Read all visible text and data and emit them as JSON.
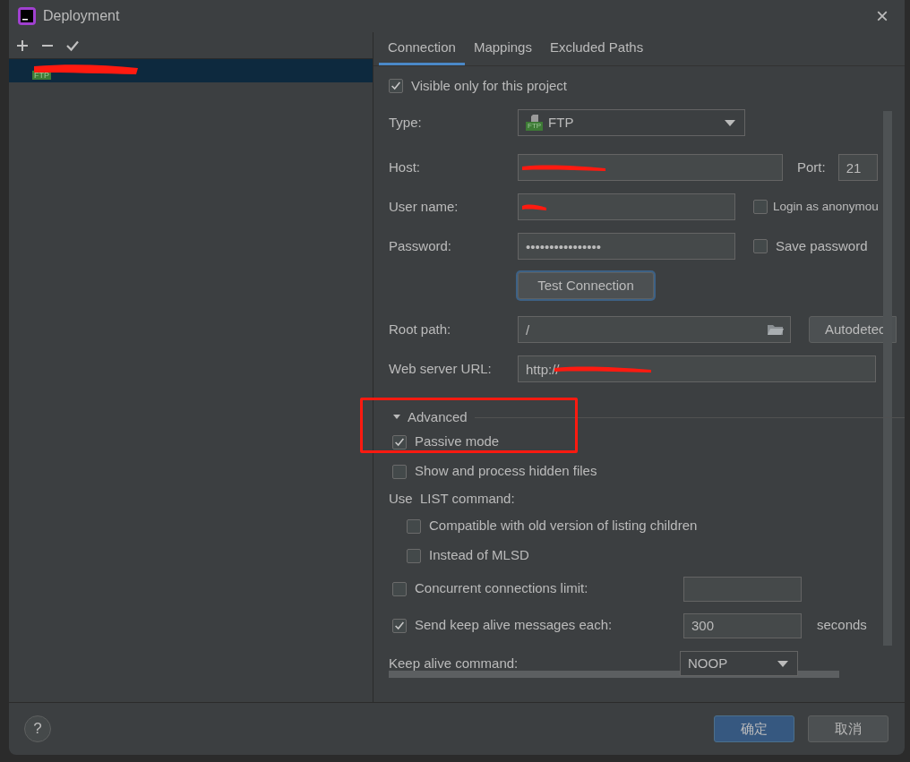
{
  "window": {
    "title": "Deployment",
    "close": "×"
  },
  "toolbar": [
    {
      "kind": "add"
    },
    {
      "kind": "remove"
    },
    {
      "kind": "check"
    }
  ],
  "servers": [
    {
      "badge": "FTP",
      "selected": true,
      "redacted": true
    }
  ],
  "tabs": [
    {
      "label": "Connection",
      "selected": true
    },
    {
      "label": "Mappings",
      "selected": false
    },
    {
      "label": "Excluded Paths",
      "selected": false
    }
  ],
  "visible_only": {
    "label": "Visible only for this project",
    "checked": true
  },
  "type": {
    "label": "Type:",
    "value": "FTP",
    "badge": "FTP"
  },
  "host": {
    "label": "Host:",
    "redacted": true,
    "port_label": "Port:",
    "port": "21"
  },
  "user_name": {
    "label": "User name:",
    "redacted": true,
    "option": {
      "label": "Login as anonymou",
      "checked": false
    }
  },
  "password": {
    "label": "Password:",
    "value": "••••••••••••••••",
    "option": {
      "label": "Save password",
      "checked": false
    }
  },
  "test_button": "Test Connection",
  "root_path": {
    "label": "Root path:",
    "value": "/",
    "button": "Autodetec"
  },
  "web_server_url": {
    "label": "Web server URL:",
    "value": "http://",
    "redacted": true
  },
  "advanced": {
    "title": "Advanced",
    "expanded": true,
    "items": [
      {
        "kind": "checkbox",
        "label": "Passive mode",
        "checked": true,
        "highlighted": true
      },
      {
        "kind": "checkbox",
        "label": "Show and process hidden files",
        "checked": false,
        "highlighted": false
      },
      {
        "kind": "heading",
        "label": "Use  LIST command:",
        "children": [
          {
            "kind": "checkbox",
            "label": "Compatible with old version of listing children",
            "checked": false,
            "highlighted": false
          },
          {
            "kind": "checkbox",
            "label": "Instead of MLSD",
            "checked": false,
            "highlighted": false
          }
        ]
      },
      {
        "kind": "checkbox_field",
        "label": "Concurrent connections limit:",
        "checked": false
      },
      {
        "kind": "checkbox_field",
        "label": "Send keep alive messages each:",
        "checked": true,
        "value": "300",
        "suffix": "seconds"
      },
      {
        "kind": "select",
        "label": "Keep alive command:",
        "value": "NOOP"
      }
    ]
  },
  "footer": {
    "help": "?",
    "buttons": [
      {
        "label": "确定",
        "kind": "primary"
      },
      {
        "label": "取消",
        "kind": "secondary"
      }
    ]
  }
}
